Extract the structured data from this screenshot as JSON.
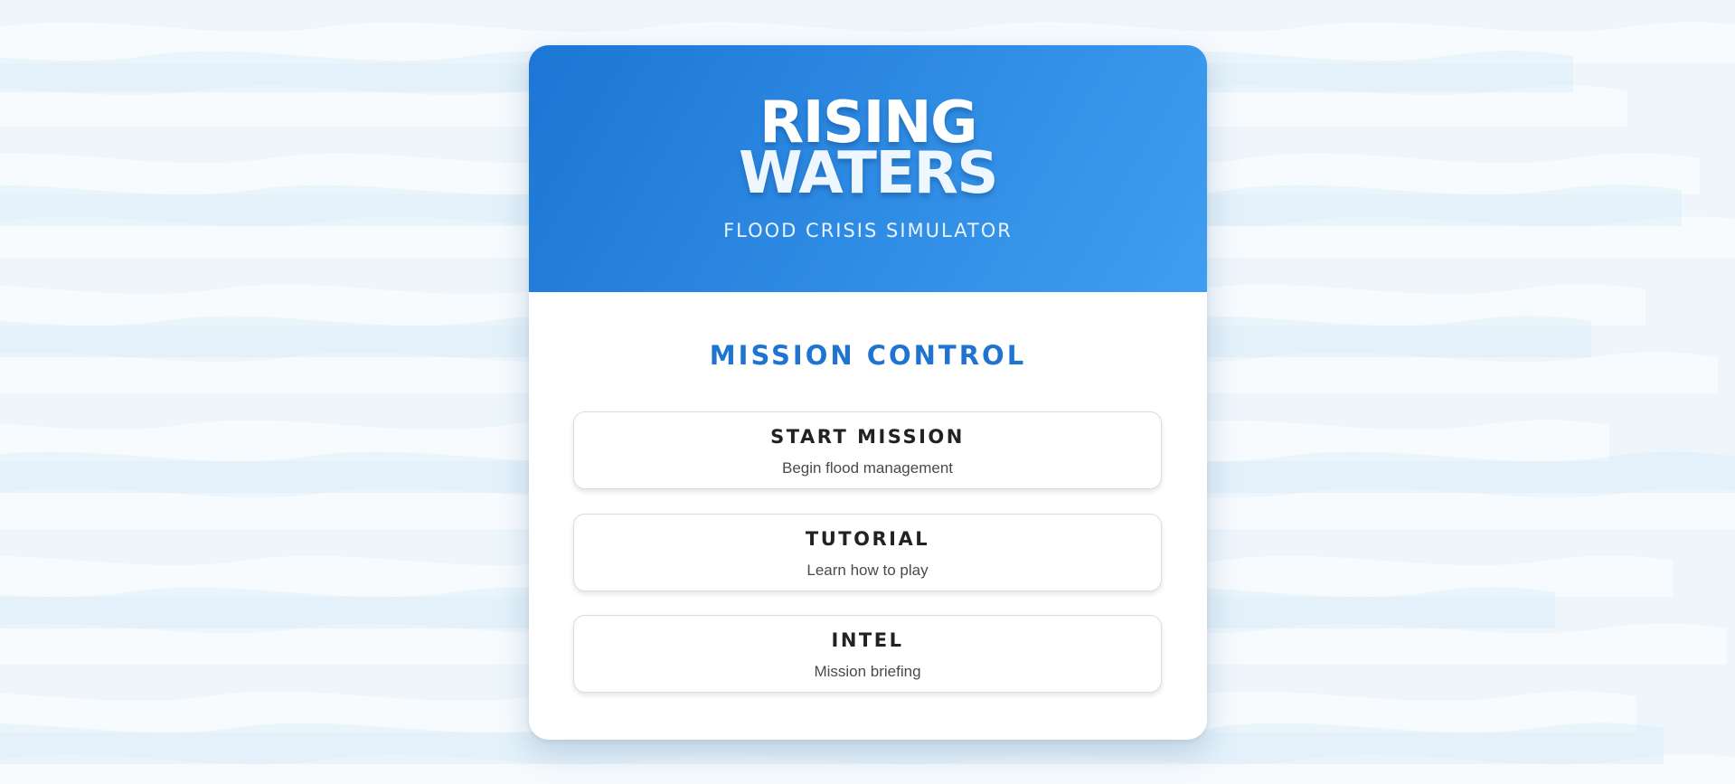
{
  "header": {
    "title_line1": "RISING",
    "title_line2": "WATERS",
    "subtitle": "FLOOD CRISIS SIMULATOR"
  },
  "menu": {
    "heading": "MISSION CONTROL",
    "items": [
      {
        "label": "START MISSION",
        "description": "Begin flood management"
      },
      {
        "label": "TUTORIAL",
        "description": "Learn how to play"
      },
      {
        "label": "INTEL",
        "description": "Mission briefing"
      }
    ]
  },
  "colors": {
    "header_gradient_start": "#1c76d5",
    "header_gradient_end": "#3f9ef0",
    "accent": "#1f74d1",
    "background": "#eef6fc"
  }
}
